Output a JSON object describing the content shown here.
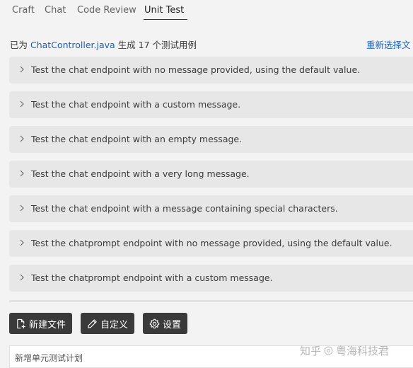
{
  "tabs": [
    {
      "label": "Craft"
    },
    {
      "label": "Chat"
    },
    {
      "label": "Code Review"
    },
    {
      "label": "Unit Test",
      "active": true
    }
  ],
  "summary": {
    "prefix": "已为",
    "file": "ChatController.java",
    "suffix": "生成 17 个测试用例",
    "reselect": "重新选择文"
  },
  "tests": [
    {
      "label": "Test the chat endpoint with no message provided, using the default value."
    },
    {
      "label": "Test the chat endpoint with a custom message."
    },
    {
      "label": "Test the chat endpoint with an empty message."
    },
    {
      "label": "Test the chat endpoint with a very long message."
    },
    {
      "label": "Test the chat endpoint with a message containing special characters."
    },
    {
      "label": "Test the chatprompt endpoint with no message provided, using the default value."
    },
    {
      "label": "Test the chatprompt endpoint with a custom message."
    }
  ],
  "buttons": {
    "new_file": "新建文件",
    "customize": "自定义",
    "settings": "设置"
  },
  "plan": {
    "label": "新增单元测试计划"
  },
  "watermark": {
    "left": "知乎",
    "right": "粤海科技君"
  },
  "icons": {
    "expand": "chevron-right-icon",
    "new_file": "new-file-icon",
    "customize": "pencil-icon",
    "settings": "gear-icon"
  }
}
